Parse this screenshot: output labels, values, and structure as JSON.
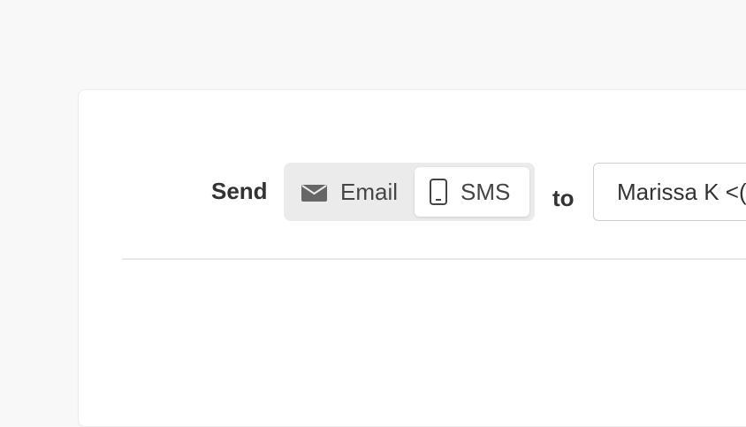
{
  "compose": {
    "send_label": "Send",
    "to_label": "to",
    "channels": [
      {
        "label": "Email",
        "icon": "envelope-icon",
        "selected": false
      },
      {
        "label": "SMS",
        "icon": "mobile-phone-icon",
        "selected": true
      }
    ],
    "recipient_value": "Marissa K <("
  }
}
